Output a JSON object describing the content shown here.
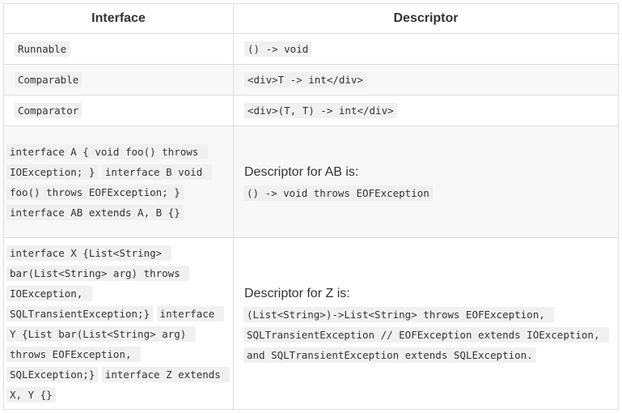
{
  "table": {
    "headers": {
      "interface": "Interface",
      "descriptor": "Descriptor"
    },
    "rows": [
      {
        "interface": [
          "Runnable"
        ],
        "descriptor_text": "",
        "descriptor": "() -> void"
      },
      {
        "interface": [
          "Comparable"
        ],
        "descriptor_text": "",
        "descriptor": "<div>T -> int</div>"
      },
      {
        "interface": [
          "Comparator"
        ],
        "descriptor_text": "",
        "descriptor": "<div>(T, T) -> int</div>"
      },
      {
        "interface": [
          "interface A { void foo() throws IOException; }",
          "interface B void foo() throws EOFException; }",
          "interface AB extends A, B {}"
        ],
        "descriptor_text": "Descriptor for AB is:",
        "descriptor": "() -> void throws EOFException"
      },
      {
        "interface": [
          "interface X {List<String> bar(List<String> arg) throws IOException, SQLTransientException;}",
          "interface Y {List bar(List<String> arg) throws EOFException, SQLException;}",
          "interface Z extends X, Y {}"
        ],
        "descriptor_text": "Descriptor for Z is:",
        "descriptor": "(List<String>)->List<String> throws EOFException, SQLTransientException // EOFException extends IOException, and SQLTransientException extends SQLException."
      }
    ]
  }
}
